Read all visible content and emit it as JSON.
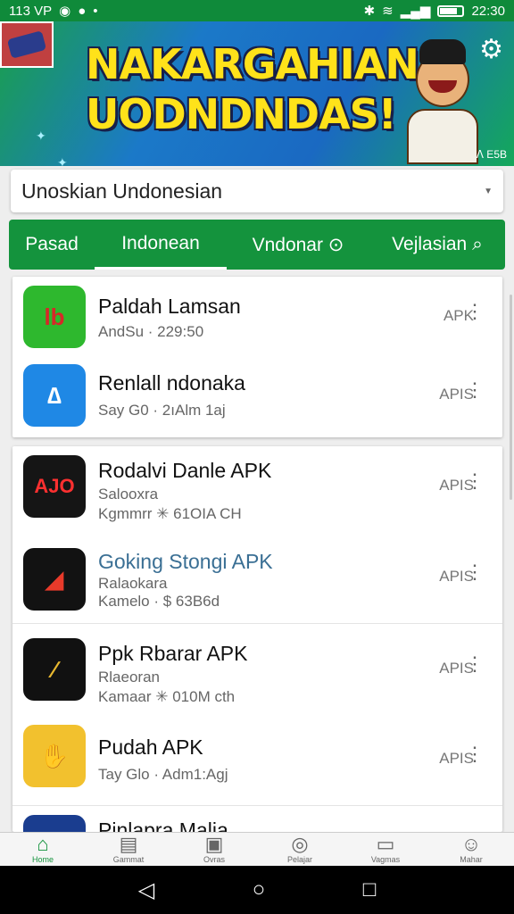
{
  "status_bar": {
    "time_left": "113 VP",
    "time_right": "22:30"
  },
  "banner": {
    "title_line1": "NAKARGAHIAN",
    "title_line2": "UODNDNDAS!",
    "corner_text": "ᐱ E5B"
  },
  "search": {
    "value": "Unoskian Undonesian"
  },
  "tabs": [
    {
      "label": "Pasad"
    },
    {
      "label": "Indonean"
    },
    {
      "label": "Vndonar ⊙"
    },
    {
      "label": "Vejlasian ⌕"
    }
  ],
  "card1": [
    {
      "name": "Paldah Lamsan",
      "sub": "AndSu · 229:50",
      "badge": "APK",
      "icon_text": "lb",
      "icon_color": "#2eb82e"
    },
    {
      "name": "Renlall ndonaka",
      "sub": "Say G0 · 2ıAlm 1aj",
      "badge": "APIS",
      "icon_text": "∆",
      "icon_color": "#1f88e5"
    }
  ],
  "card2": [
    {
      "name": "Rodalvi Danle APK",
      "sub1": "Salooxra",
      "sub2": "Kgmmrr ✳ 61OIA CH",
      "badge": "APIS",
      "icon_text": "AJO",
      "icon_color": "#151515"
    },
    {
      "name": "Goking Stongi APK",
      "sub1": "Ralaokara",
      "sub2": "Kamelo · $ 63B6d",
      "badge": "APIS",
      "icon_text": "◢",
      "icon_color": "#121212"
    },
    {
      "name": "Ppk Rbarar APK",
      "sub1": "Rlaeoran",
      "sub2": "Kamaar ✳ 010M cth",
      "badge": "APIS",
      "icon_text": "∕",
      "icon_color": "#111111"
    },
    {
      "name": "Pudah APK",
      "sub1": "Tay Glo · Adm1:Agj",
      "sub2": "",
      "badge": "APIS",
      "icon_text": "✋",
      "icon_color": "#f2c12e"
    },
    {
      "name": "Pinlapra Malia",
      "sub1": "",
      "sub2": "",
      "badge": "",
      "icon_text": "",
      "icon_color": "#1a3d8f"
    }
  ],
  "bottom_nav": [
    {
      "label": "Home",
      "icon": "home-icon",
      "glyph": "⌂"
    },
    {
      "label": "Gammat",
      "icon": "grid-icon",
      "glyph": "▤"
    },
    {
      "label": "Ovras",
      "icon": "apps-icon",
      "glyph": "▣"
    },
    {
      "label": "Pelajar",
      "icon": "compass-icon",
      "glyph": "◎"
    },
    {
      "label": "Vagmas",
      "icon": "library-icon",
      "glyph": "▭"
    },
    {
      "label": "Mahar",
      "icon": "profile-icon",
      "glyph": "☺"
    }
  ]
}
